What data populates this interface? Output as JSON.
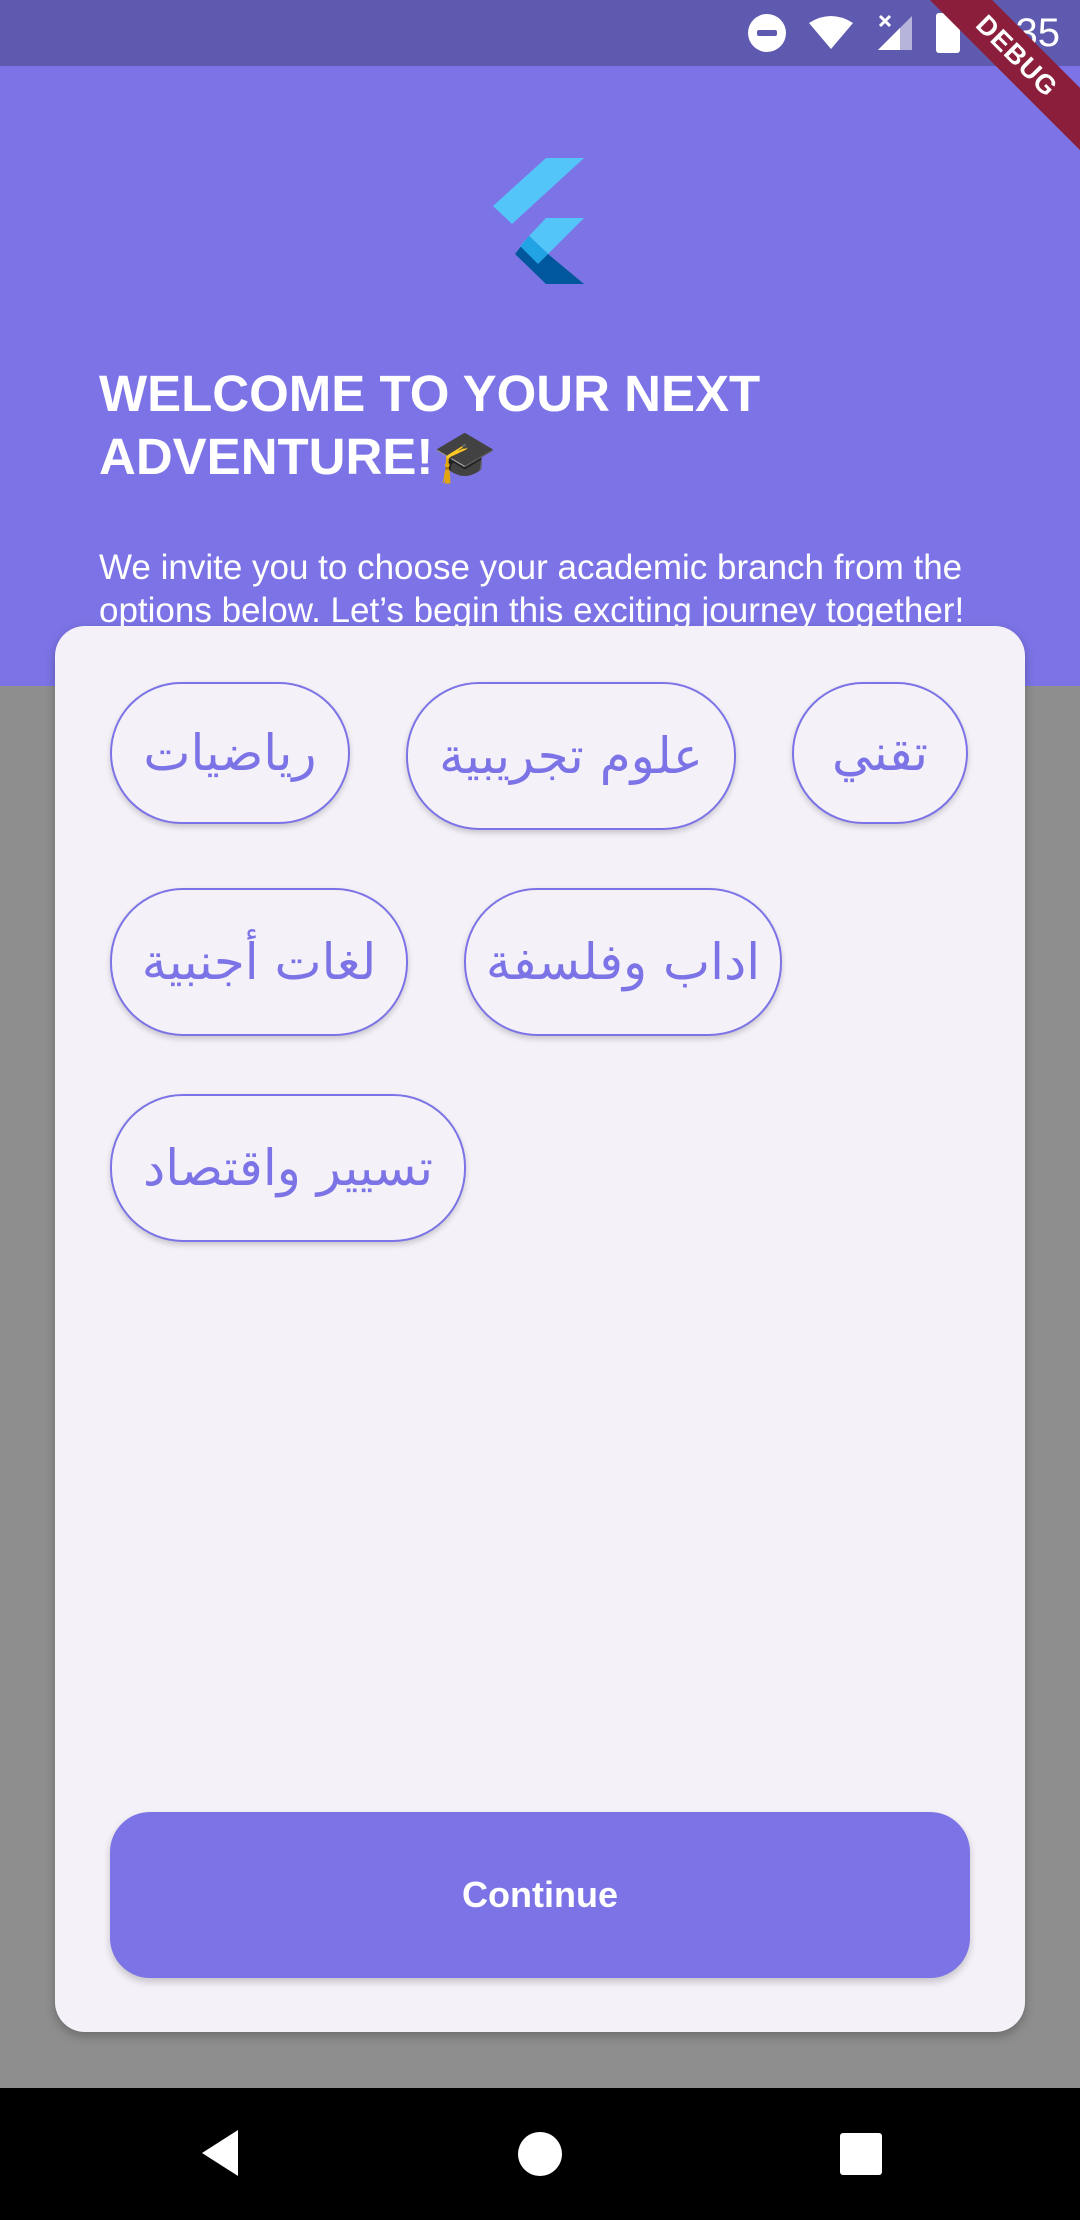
{
  "status_bar": {
    "time": "4:35",
    "icons": [
      "dnd-icon",
      "wifi-icon",
      "signal-icon",
      "battery-icon"
    ]
  },
  "debug_banner": "DEBUG",
  "header": {
    "logo": "flutter-logo",
    "title": "WELCOME TO YOUR NEXT ADVENTURE!🎓",
    "subtitle": "We invite you to choose your academic branch from the options below. Let’s begin this exciting journey together!"
  },
  "branches": [
    {
      "label": "رياضيات"
    },
    {
      "label": "علوم تجريبية"
    },
    {
      "label": "تقني"
    },
    {
      "label": "لغات أجنبية"
    },
    {
      "label": "اداب وفلسفة"
    },
    {
      "label": "تسيير واقتصاد"
    }
  ],
  "continue_button": "Continue",
  "colors": {
    "primary": "#7c74e6",
    "status_bar": "#5e5aaf",
    "card": "#f5f1f9",
    "scrim": "#8e8e8e"
  },
  "nav_bar": [
    "back-icon",
    "home-icon",
    "recents-icon"
  ]
}
